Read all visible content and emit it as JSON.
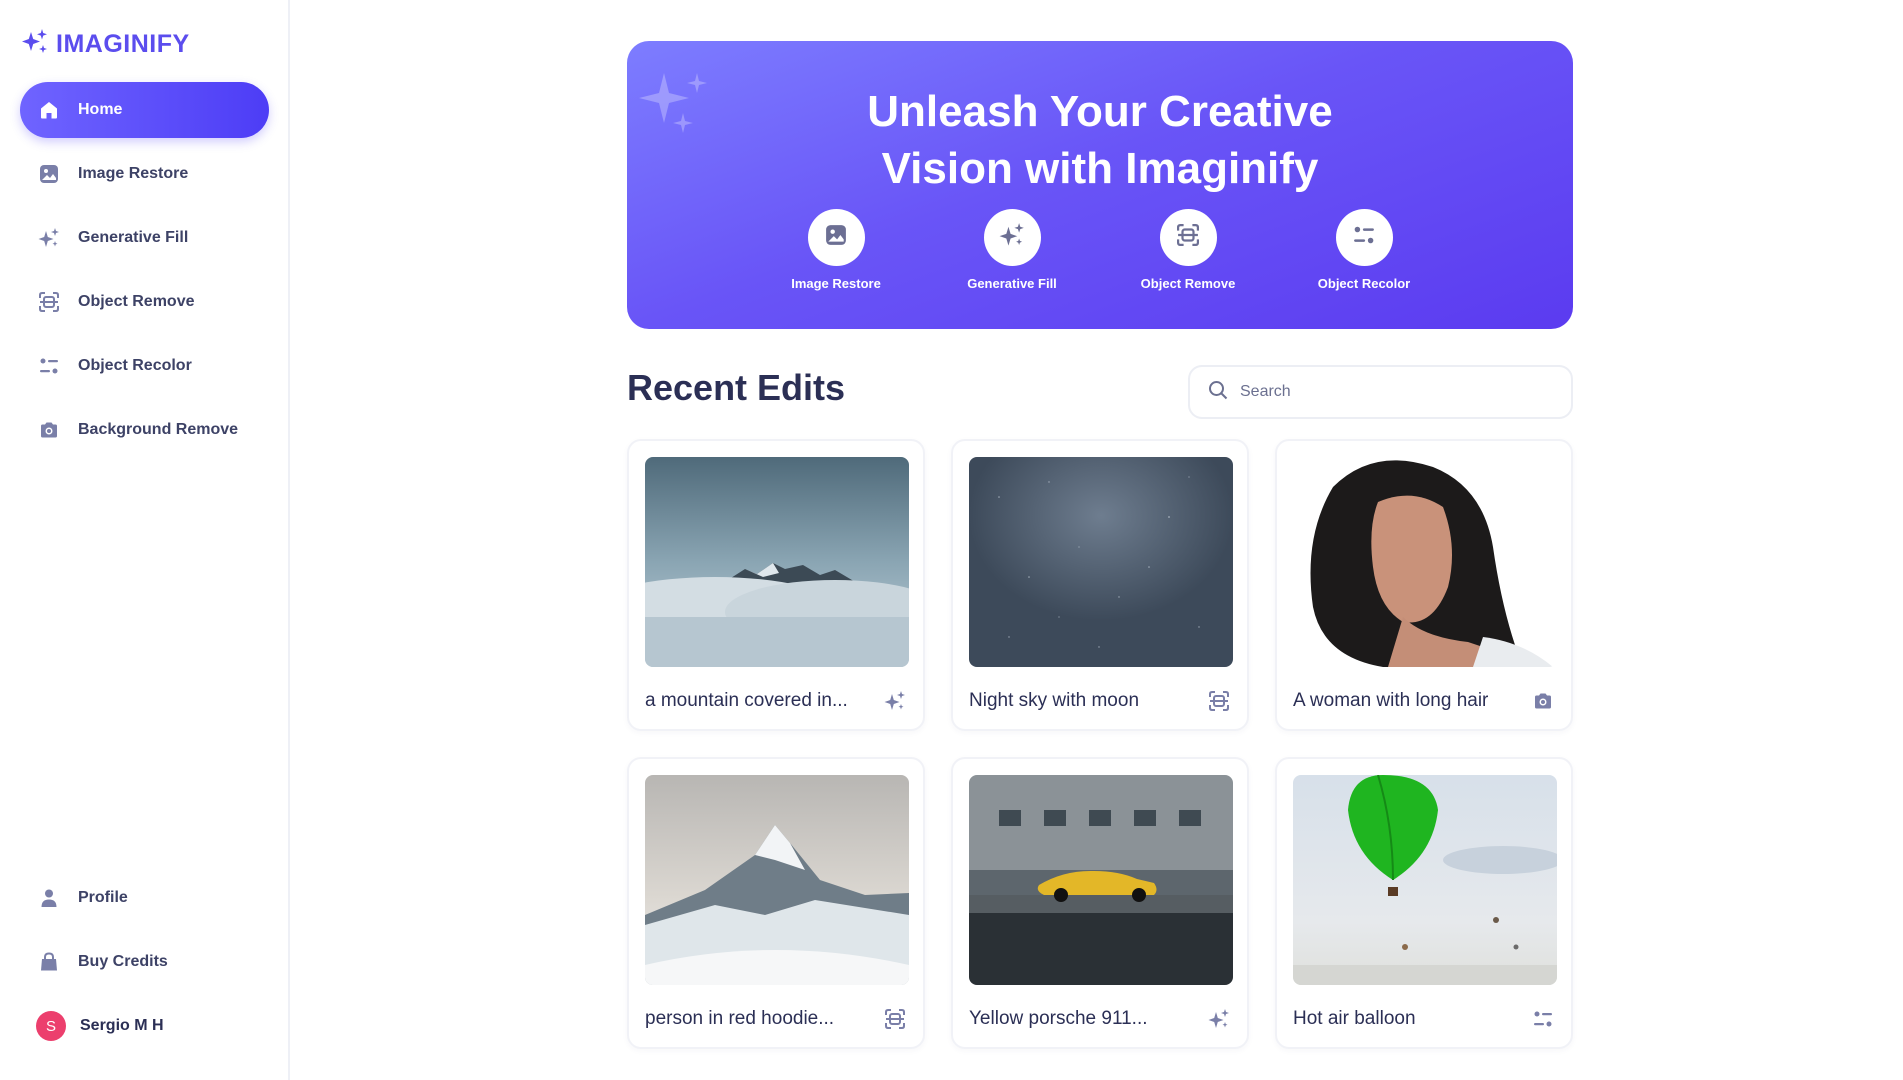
{
  "app": {
    "brand": "IMAGINIFY"
  },
  "sidebar": {
    "items": [
      {
        "label": "Home",
        "icon": "home-icon",
        "active": true
      },
      {
        "label": "Image Restore",
        "icon": "image-icon"
      },
      {
        "label": "Generative Fill",
        "icon": "stars-icon"
      },
      {
        "label": "Object Remove",
        "icon": "scan-icon"
      },
      {
        "label": "Object Recolor",
        "icon": "filter-icon"
      },
      {
        "label": "Background Remove",
        "icon": "camera-icon"
      }
    ],
    "bottom": [
      {
        "label": "Profile",
        "icon": "profile-icon"
      },
      {
        "label": "Buy Credits",
        "icon": "bag-icon"
      }
    ],
    "user": {
      "initial": "S",
      "name": "Sergio M H"
    }
  },
  "hero": {
    "title_line1": "Unleash Your Creative",
    "title_line2": "Vision with Imaginify",
    "actions": [
      {
        "label": "Image Restore",
        "icon": "image-icon"
      },
      {
        "label": "Generative Fill",
        "icon": "stars-icon"
      },
      {
        "label": "Object Remove",
        "icon": "scan-icon"
      },
      {
        "label": "Object Recolor",
        "icon": "filter-icon"
      }
    ]
  },
  "recent": {
    "title": "Recent Edits",
    "search_placeholder": "Search",
    "cards": [
      {
        "title": "a mountain covered in...",
        "icon": "stars-icon"
      },
      {
        "title": "Night sky with moon",
        "icon": "scan-icon"
      },
      {
        "title": "A woman with long hair",
        "icon": "camera-icon"
      },
      {
        "title": "person in red hoodie...",
        "icon": "scan-icon"
      },
      {
        "title": "Yellow porsche 911...",
        "icon": "stars-icon"
      },
      {
        "title": "Hot air balloon",
        "icon": "filter-icon"
      }
    ]
  },
  "colors": {
    "accent": "#5b4dee",
    "text": "#2b2f55",
    "icon": "#7a7fa8"
  }
}
